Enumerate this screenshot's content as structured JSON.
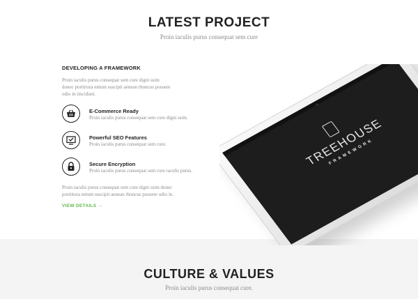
{
  "latest": {
    "title": "LATEST PROJECT",
    "subtitle": "Proin iaculis purus consequat sem cure"
  },
  "project": {
    "heading": "DEVELOPING A FRAMEWORK",
    "intro_line1": "Proin iaculis purus consequat sem cure  digni ssim",
    "intro_line2": "donec porttitora entum suscipit  aenean rhoncus posuere",
    "intro_line3": "odio in tincidunt.",
    "features": [
      {
        "title": "E-Commerce Ready",
        "desc": "Proin iaculis purus consequat sem cure  digni ssim.",
        "icon": "basket-icon"
      },
      {
        "title": "Powerful SEO Features",
        "desc": "Proin iaculis purus consequat sem cure.",
        "icon": "monitor-check-icon"
      },
      {
        "title": "Secure Encryption",
        "desc": "Proin iaculis purus consequat sem cure iaculis purus.",
        "icon": "lock-icon"
      }
    ],
    "outro_line1": "Proin iaculis purus consequat sem cure  digni ssim donec",
    "outro_line2": "porttitora entum suscipit  aenean rhoncus posuere odio in.",
    "view_details": "VIEW DETAILS →"
  },
  "tablet": {
    "brand": "TREEHOUSE",
    "brand_sub": "FRAMEWORK"
  },
  "culture": {
    "title": "CULTURE & VALUES",
    "subtitle": "Proin iaculis purus consequat cure."
  },
  "colors": {
    "accent": "#5cbb4b",
    "heading": "#222222",
    "muted": "#8a8a8a",
    "footer_bg": "#f4f4f4"
  }
}
